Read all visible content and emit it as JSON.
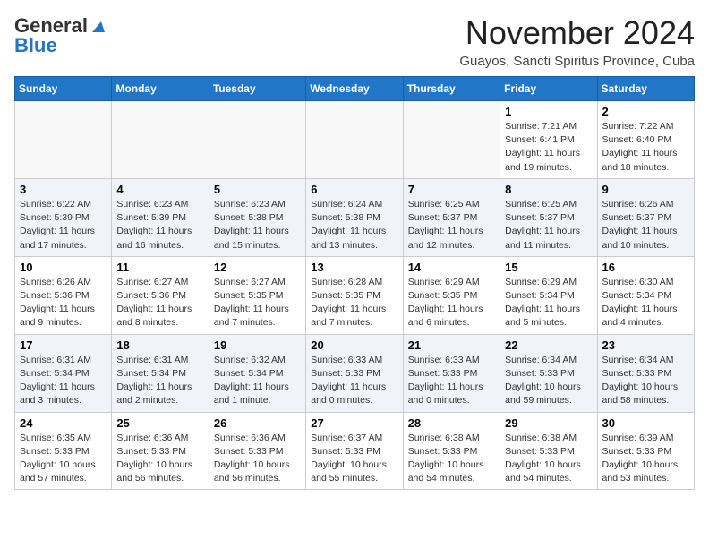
{
  "header": {
    "logo_general": "General",
    "logo_blue": "Blue",
    "month_title": "November 2024",
    "subtitle": "Guayos, Sancti Spiritus Province, Cuba"
  },
  "days_of_week": [
    "Sunday",
    "Monday",
    "Tuesday",
    "Wednesday",
    "Thursday",
    "Friday",
    "Saturday"
  ],
  "weeks": [
    [
      {
        "day": "",
        "info": ""
      },
      {
        "day": "",
        "info": ""
      },
      {
        "day": "",
        "info": ""
      },
      {
        "day": "",
        "info": ""
      },
      {
        "day": "",
        "info": ""
      },
      {
        "day": "1",
        "info": "Sunrise: 7:21 AM\nSunset: 6:41 PM\nDaylight: 11 hours and 19 minutes."
      },
      {
        "day": "2",
        "info": "Sunrise: 7:22 AM\nSunset: 6:40 PM\nDaylight: 11 hours and 18 minutes."
      }
    ],
    [
      {
        "day": "3",
        "info": "Sunrise: 6:22 AM\nSunset: 5:39 PM\nDaylight: 11 hours and 17 minutes."
      },
      {
        "day": "4",
        "info": "Sunrise: 6:23 AM\nSunset: 5:39 PM\nDaylight: 11 hours and 16 minutes."
      },
      {
        "day": "5",
        "info": "Sunrise: 6:23 AM\nSunset: 5:38 PM\nDaylight: 11 hours and 15 minutes."
      },
      {
        "day": "6",
        "info": "Sunrise: 6:24 AM\nSunset: 5:38 PM\nDaylight: 11 hours and 13 minutes."
      },
      {
        "day": "7",
        "info": "Sunrise: 6:25 AM\nSunset: 5:37 PM\nDaylight: 11 hours and 12 minutes."
      },
      {
        "day": "8",
        "info": "Sunrise: 6:25 AM\nSunset: 5:37 PM\nDaylight: 11 hours and 11 minutes."
      },
      {
        "day": "9",
        "info": "Sunrise: 6:26 AM\nSunset: 5:37 PM\nDaylight: 11 hours and 10 minutes."
      }
    ],
    [
      {
        "day": "10",
        "info": "Sunrise: 6:26 AM\nSunset: 5:36 PM\nDaylight: 11 hours and 9 minutes."
      },
      {
        "day": "11",
        "info": "Sunrise: 6:27 AM\nSunset: 5:36 PM\nDaylight: 11 hours and 8 minutes."
      },
      {
        "day": "12",
        "info": "Sunrise: 6:27 AM\nSunset: 5:35 PM\nDaylight: 11 hours and 7 minutes."
      },
      {
        "day": "13",
        "info": "Sunrise: 6:28 AM\nSunset: 5:35 PM\nDaylight: 11 hours and 7 minutes."
      },
      {
        "day": "14",
        "info": "Sunrise: 6:29 AM\nSunset: 5:35 PM\nDaylight: 11 hours and 6 minutes."
      },
      {
        "day": "15",
        "info": "Sunrise: 6:29 AM\nSunset: 5:34 PM\nDaylight: 11 hours and 5 minutes."
      },
      {
        "day": "16",
        "info": "Sunrise: 6:30 AM\nSunset: 5:34 PM\nDaylight: 11 hours and 4 minutes."
      }
    ],
    [
      {
        "day": "17",
        "info": "Sunrise: 6:31 AM\nSunset: 5:34 PM\nDaylight: 11 hours and 3 minutes."
      },
      {
        "day": "18",
        "info": "Sunrise: 6:31 AM\nSunset: 5:34 PM\nDaylight: 11 hours and 2 minutes."
      },
      {
        "day": "19",
        "info": "Sunrise: 6:32 AM\nSunset: 5:34 PM\nDaylight: 11 hours and 1 minute."
      },
      {
        "day": "20",
        "info": "Sunrise: 6:33 AM\nSunset: 5:33 PM\nDaylight: 11 hours and 0 minutes."
      },
      {
        "day": "21",
        "info": "Sunrise: 6:33 AM\nSunset: 5:33 PM\nDaylight: 11 hours and 0 minutes."
      },
      {
        "day": "22",
        "info": "Sunrise: 6:34 AM\nSunset: 5:33 PM\nDaylight: 10 hours and 59 minutes."
      },
      {
        "day": "23",
        "info": "Sunrise: 6:34 AM\nSunset: 5:33 PM\nDaylight: 10 hours and 58 minutes."
      }
    ],
    [
      {
        "day": "24",
        "info": "Sunrise: 6:35 AM\nSunset: 5:33 PM\nDaylight: 10 hours and 57 minutes."
      },
      {
        "day": "25",
        "info": "Sunrise: 6:36 AM\nSunset: 5:33 PM\nDaylight: 10 hours and 56 minutes."
      },
      {
        "day": "26",
        "info": "Sunrise: 6:36 AM\nSunset: 5:33 PM\nDaylight: 10 hours and 56 minutes."
      },
      {
        "day": "27",
        "info": "Sunrise: 6:37 AM\nSunset: 5:33 PM\nDaylight: 10 hours and 55 minutes."
      },
      {
        "day": "28",
        "info": "Sunrise: 6:38 AM\nSunset: 5:33 PM\nDaylight: 10 hours and 54 minutes."
      },
      {
        "day": "29",
        "info": "Sunrise: 6:38 AM\nSunset: 5:33 PM\nDaylight: 10 hours and 54 minutes."
      },
      {
        "day": "30",
        "info": "Sunrise: 6:39 AM\nSunset: 5:33 PM\nDaylight: 10 hours and 53 minutes."
      }
    ]
  ]
}
